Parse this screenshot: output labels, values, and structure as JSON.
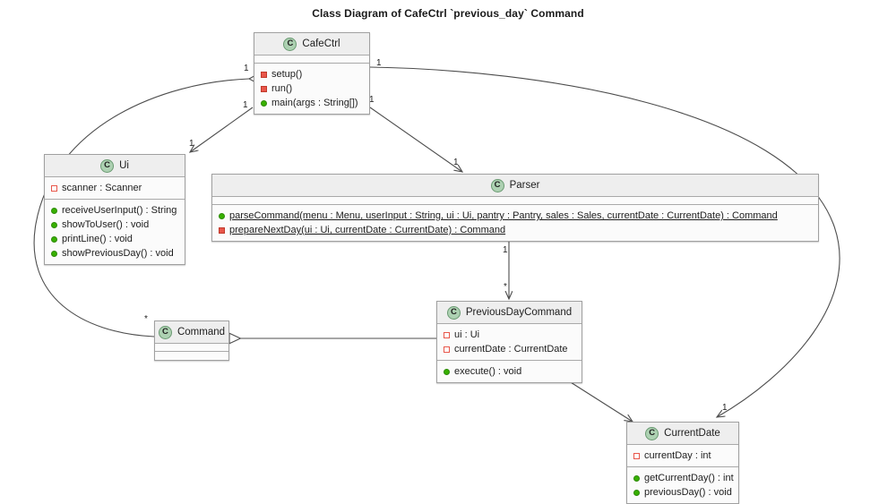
{
  "diagram": {
    "title": "Class Diagram of CafeCtrl `previous_day` Command",
    "type": "uml-class-diagram",
    "classes": [
      {
        "id": "cafectrl",
        "name": "CafeCtrl",
        "stereotype_icon": "C",
        "attributes": [],
        "methods": [
          {
            "label": "setup()",
            "visibility": "private",
            "static": false
          },
          {
            "label": "run()",
            "visibility": "private",
            "static": false
          },
          {
            "label": "main(args : String[])",
            "visibility": "public",
            "static": false
          }
        ]
      },
      {
        "id": "ui",
        "name": "Ui",
        "stereotype_icon": "C",
        "attributes": [
          {
            "label": "scanner : Scanner",
            "visibility": "private-field",
            "static": false
          }
        ],
        "methods": [
          {
            "label": "receiveUserInput() : String",
            "visibility": "public",
            "static": false
          },
          {
            "label": "showToUser() : void",
            "visibility": "public",
            "static": false
          },
          {
            "label": "printLine() : void",
            "visibility": "public",
            "static": false
          },
          {
            "label": "showPreviousDay() : void",
            "visibility": "public",
            "static": false
          }
        ]
      },
      {
        "id": "parser",
        "name": "Parser",
        "stereotype_icon": "C",
        "attributes": [],
        "methods": [
          {
            "label": "parseCommand(menu : Menu, userInput : String, ui : Ui, pantry : Pantry, sales : Sales, currentDate : CurrentDate) : Command",
            "visibility": "public",
            "static": true
          },
          {
            "label": "prepareNextDay(ui : Ui, currentDate : CurrentDate) : Command",
            "visibility": "private",
            "static": true
          }
        ]
      },
      {
        "id": "command",
        "name": "Command",
        "stereotype_icon": "C",
        "attributes": [],
        "methods": []
      },
      {
        "id": "previousdaycommand",
        "name": "PreviousDayCommand",
        "stereotype_icon": "C",
        "attributes": [
          {
            "label": "ui : Ui",
            "visibility": "private-field",
            "static": false
          },
          {
            "label": "currentDate : CurrentDate",
            "visibility": "private-field",
            "static": false
          }
        ],
        "methods": [
          {
            "label": "execute() : void",
            "visibility": "public",
            "static": false
          }
        ]
      },
      {
        "id": "currentdate",
        "name": "CurrentDate",
        "stereotype_icon": "C",
        "attributes": [
          {
            "label": "currentDay : int",
            "visibility": "private-field",
            "static": false
          }
        ],
        "methods": [
          {
            "label": "getCurrentDay() : int",
            "visibility": "public",
            "static": false
          },
          {
            "label": "previousDay() : void",
            "visibility": "public",
            "static": false
          }
        ]
      }
    ],
    "relationships": [
      {
        "from": "cafectrl",
        "to": "command",
        "kind": "aggregation",
        "from_mult": "1",
        "to_mult": "*"
      },
      {
        "from": "cafectrl",
        "to": "ui",
        "kind": "association",
        "from_mult": "1",
        "to_mult": "1"
      },
      {
        "from": "cafectrl",
        "to": "parser",
        "kind": "association",
        "from_mult": "1",
        "to_mult": "1"
      },
      {
        "from": "cafectrl",
        "to": "currentdate",
        "kind": "association",
        "from_mult": "1",
        "to_mult": "1"
      },
      {
        "from": "parser",
        "to": "previousdaycommand",
        "kind": "association",
        "from_mult": "1",
        "to_mult": "*"
      },
      {
        "from": "previousdaycommand",
        "to": "command",
        "kind": "generalization",
        "from_mult": "",
        "to_mult": ""
      },
      {
        "from": "previousdaycommand",
        "to": "currentdate",
        "kind": "association",
        "from_mult": "",
        "to_mult": ""
      }
    ],
    "multiplicity_labels": [
      {
        "id": "m-cafectrl-command",
        "text": "1"
      },
      {
        "id": "m-command-star",
        "text": "*"
      },
      {
        "id": "m-cafectrl-ui-src",
        "text": "1"
      },
      {
        "id": "m-cafectrl-ui-dst",
        "text": "1"
      },
      {
        "id": "m-cafectrl-parser-src",
        "text": "1"
      },
      {
        "id": "m-cafectrl-parser-dst",
        "text": "1"
      },
      {
        "id": "m-cafectrl-currentdate-src",
        "text": "1"
      },
      {
        "id": "m-cafectrl-currentdate-dst",
        "text": "1"
      },
      {
        "id": "m-parser-pdc-src",
        "text": "1"
      },
      {
        "id": "m-parser-pdc-dst",
        "text": "*"
      }
    ],
    "colors": {
      "class_badge": "#ADD1B2",
      "header_bg": "#EEEEEE",
      "body_bg": "#FBFBFB",
      "border": "#A0A0A0",
      "public_marker": "#38B000",
      "private_marker": "#E8564A",
      "line": "#4D4D4D",
      "background": "#FFFFFF"
    }
  }
}
